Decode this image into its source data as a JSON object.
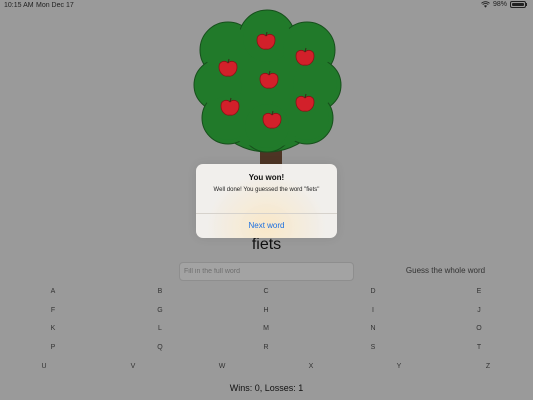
{
  "status_bar": {
    "time": "10:15 AM",
    "date": "Mon Dec 17",
    "battery": "98%",
    "icons": [
      "wifi-icon",
      "battery-icon"
    ]
  },
  "game": {
    "word": "fiets",
    "input_placeholder": "Fill in the full word",
    "guess_whole_label": "Guess the whole word",
    "score": "Wins: 0, Losses: 1",
    "apple_count": 7
  },
  "keyboard": {
    "rows": [
      [
        "A",
        "B",
        "C",
        "D",
        "E"
      ],
      [
        "F",
        "G",
        "H",
        "I",
        "J"
      ],
      [
        "K",
        "L",
        "M",
        "N",
        "O"
      ],
      [
        "P",
        "Q",
        "R",
        "S",
        "T"
      ],
      [
        "U",
        "V",
        "W",
        "X",
        "Y",
        "Z"
      ]
    ]
  },
  "dialog": {
    "title": "You won!",
    "message": "Well done! You guessed the word \"fiets\"",
    "button": "Next word"
  },
  "colors": {
    "background": "#9a9a9a",
    "foliage": "#217a2a",
    "foliage_outline": "#174f1c",
    "trunk": "#4d3424",
    "apple": "#d2202a",
    "dialog_button": "#1a6ee0"
  }
}
